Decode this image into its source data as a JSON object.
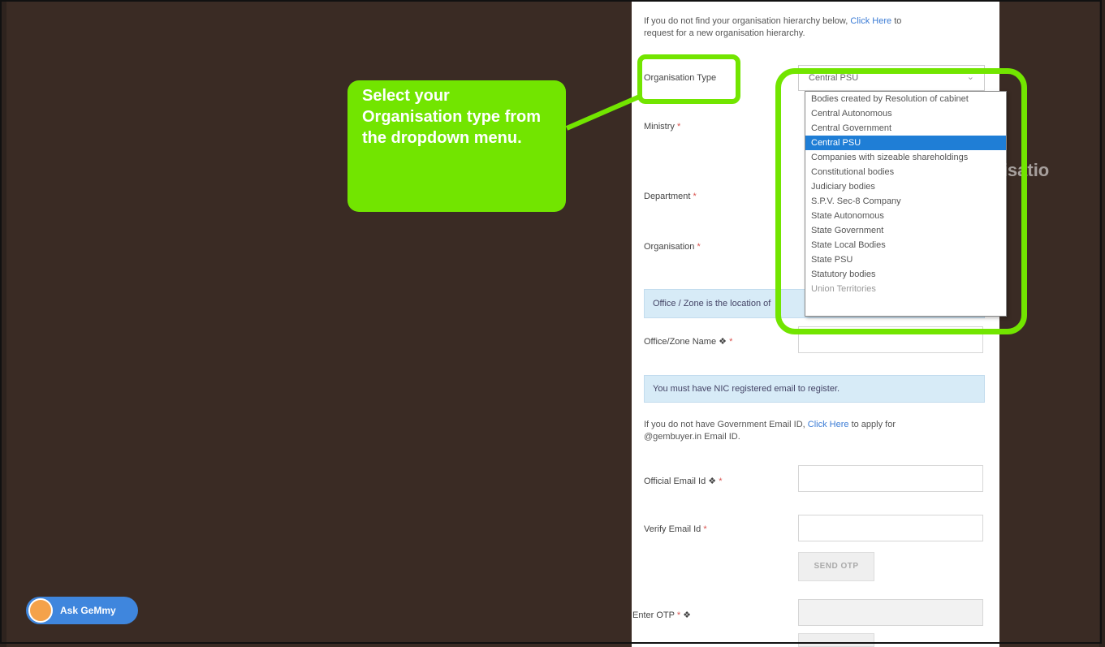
{
  "intro": {
    "text1": "If you do not find your organisation hierarchy below,",
    "link": "Click Here",
    "text2": "to",
    "text3": "request for a new organisation hierarchy."
  },
  "form": {
    "org_type_label": "Organisation Type",
    "org_type_value": "Central PSU",
    "ministry_label": "Ministry",
    "department_label": "Department",
    "organisation_label": "Organisation",
    "office_info": "Office / Zone is the location of",
    "office_zone_label": "Office/Zone Name",
    "nic_info": "You must have NIC registered email to register.",
    "gov_email_text1": "If you do not have Government Email ID,",
    "gov_email_link": "Click Here",
    "gov_email_text2": "to apply for",
    "gov_email_text3": "@gembuyer.in Email ID.",
    "official_email_label": "Official Email Id",
    "verify_email_label": "Verify Email Id",
    "send_otp": "SEND OTP",
    "enter_otp_label": "Enter OTP",
    "required_mark": "*",
    "info_icon": "info-icon"
  },
  "dropdown_options": [
    "Bodies created by Resolution of cabinet",
    "Central Autonomous",
    "Central Government",
    "Central PSU",
    "Companies with sizeable shareholdings",
    "Constitutional bodies",
    "Judiciary bodies",
    "S.P.V. Sec-8 Company",
    "State Autonomous",
    "State Government",
    "State Local Bodies",
    "State PSU",
    "Statutory bodies",
    "Union Territories"
  ],
  "selected_option": "Central PSU",
  "callout": {
    "text": "Select your Organisation type from the dropdown menu."
  },
  "ghost_text": "Organisatio",
  "ask_gemmy": {
    "label": "Ask GeMmy"
  },
  "colors": {
    "highlight": "#72e500",
    "selected": "#1f7ed6",
    "link": "#3a7bd5",
    "background": "#3a2b24"
  }
}
